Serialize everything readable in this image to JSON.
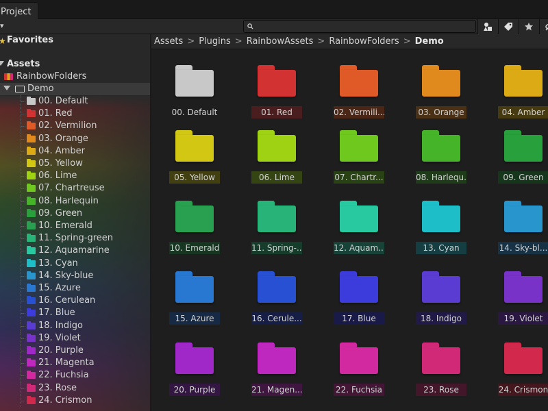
{
  "window": {
    "tab_label": "Project"
  },
  "toolbar": {
    "create_caret": "▾",
    "search_placeholder": ""
  },
  "tree": {
    "favorites_label": "Favorites",
    "assets_label": "Assets",
    "rainbow_label": "RainbowFolders",
    "demo_label": "Demo",
    "items": [
      {
        "label": "00. Default",
        "color": "#c8c8c8"
      },
      {
        "label": "01. Red",
        "color": "#d23232"
      },
      {
        "label": "02. Vermilion",
        "color": "#e05a28"
      },
      {
        "label": "03. Orange",
        "color": "#e08a1e"
      },
      {
        "label": "04. Amber",
        "color": "#dcaa14"
      },
      {
        "label": "05. Yellow",
        "color": "#d2c814"
      },
      {
        "label": "06. Lime",
        "color": "#a0d214"
      },
      {
        "label": "07. Chartreuse",
        "color": "#6ec81e"
      },
      {
        "label": "08. Harlequin",
        "color": "#46b428"
      },
      {
        "label": "09. Green",
        "color": "#28a03c"
      },
      {
        "label": "10. Emerald",
        "color": "#28a050"
      },
      {
        "label": "11. Spring-green",
        "color": "#28b478"
      },
      {
        "label": "12. Aquamarine",
        "color": "#28c8a0"
      },
      {
        "label": "13. Cyan",
        "color": "#1ebec8"
      },
      {
        "label": "14. Sky-blue",
        "color": "#2896cc"
      },
      {
        "label": "15. Azure",
        "color": "#2878d2"
      },
      {
        "label": "16. Cerulean",
        "color": "#2850d2"
      },
      {
        "label": "17. Blue",
        "color": "#3c3cdc"
      },
      {
        "label": "18. Indigo",
        "color": "#5a3cd2"
      },
      {
        "label": "19. Violet",
        "color": "#7832c8"
      },
      {
        "label": "20. Purple",
        "color": "#a028c8"
      },
      {
        "label": "21. Magenta",
        "color": "#be28be"
      },
      {
        "label": "22. Fuchsia",
        "color": "#d228a0"
      },
      {
        "label": "23. Rose",
        "color": "#d22878"
      },
      {
        "label": "24. Crismon",
        "color": "#d2284b"
      }
    ]
  },
  "breadcrumb": [
    "Assets",
    "Plugins",
    "RainbowAssets",
    "RainbowFolders",
    "Demo"
  ],
  "grid": [
    {
      "label": "00. Default",
      "color": "#c8c8c8",
      "tint": ""
    },
    {
      "label": "01. Red",
      "color": "#d23232",
      "tint": "#4a1e1e"
    },
    {
      "label": "02. Vermili...",
      "color": "#e05a28",
      "tint": "#4a2616"
    },
    {
      "label": "03. Orange",
      "color": "#e08a1e",
      "tint": "#4a3014"
    },
    {
      "label": "04. Amber",
      "color": "#dcaa14",
      "tint": "#463a10"
    },
    {
      "label": "05. Yellow",
      "color": "#d2c814",
      "tint": "#424010"
    },
    {
      "label": "06. Lime",
      "color": "#a0d214",
      "tint": "#344412"
    },
    {
      "label": "07. Chartr...",
      "color": "#6ec81e",
      "tint": "#284214"
    },
    {
      "label": "08. Harlequ...",
      "color": "#46b428",
      "tint": "#1e3c18"
    },
    {
      "label": "09. Green",
      "color": "#28a03c",
      "tint": "#16361c"
    },
    {
      "label": "10. Emerald",
      "color": "#28a050",
      "tint": "#163622"
    },
    {
      "label": "11. Spring-...",
      "color": "#28b478",
      "tint": "#163c2c"
    },
    {
      "label": "12. Aquam...",
      "color": "#28c8a0",
      "tint": "#164238"
    },
    {
      "label": "13. Cyan",
      "color": "#1ebec8",
      "tint": "#143e42"
    },
    {
      "label": "14. Sky-bl...",
      "color": "#2896cc",
      "tint": "#163244"
    },
    {
      "label": "15. Azure",
      "color": "#2878d2",
      "tint": "#162a46"
    },
    {
      "label": "16. Cerule...",
      "color": "#2850d2",
      "tint": "#161e46"
    },
    {
      "label": "17. Blue",
      "color": "#3c3cdc",
      "tint": "#1a1a48"
    },
    {
      "label": "18. Indigo",
      "color": "#5a3cd2",
      "tint": "#221a46"
    },
    {
      "label": "19. Violet",
      "color": "#7832c8",
      "tint": "#2a1842"
    },
    {
      "label": "20. Purple",
      "color": "#a028c8",
      "tint": "#341642"
    },
    {
      "label": "21. Magen...",
      "color": "#be28be",
      "tint": "#3e1640"
    },
    {
      "label": "22. Fuchsia",
      "color": "#d228a0",
      "tint": "#441636"
    },
    {
      "label": "23. Rose",
      "color": "#d22878",
      "tint": "#44162a"
    },
    {
      "label": "24. Crismon",
      "color": "#d2284b",
      "tint": "#44161e"
    }
  ]
}
